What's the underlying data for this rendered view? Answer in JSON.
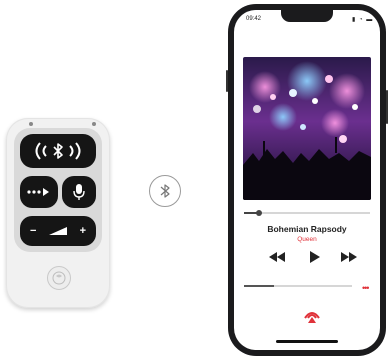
{
  "remote": {
    "bluetooth_icon": "bluetooth-icon",
    "buttons": [
      "bluetooth-button",
      "skip-button",
      "microphone-button",
      "volume-down-button",
      "volume-up-button"
    ],
    "volume_minus": "−",
    "volume_plus": "+"
  },
  "phone": {
    "status": {
      "time": "09:42",
      "icons": "▮ ◔ ▬"
    },
    "track": {
      "title": "Bohemian Rapsody",
      "artist": "Queen",
      "progress": 0.12
    },
    "volume_level": 0.28,
    "more_label": "•••"
  },
  "colors": {
    "accent": "#e0323a",
    "remote_button": "#151515",
    "phone_frame": "#1b1b1d"
  }
}
